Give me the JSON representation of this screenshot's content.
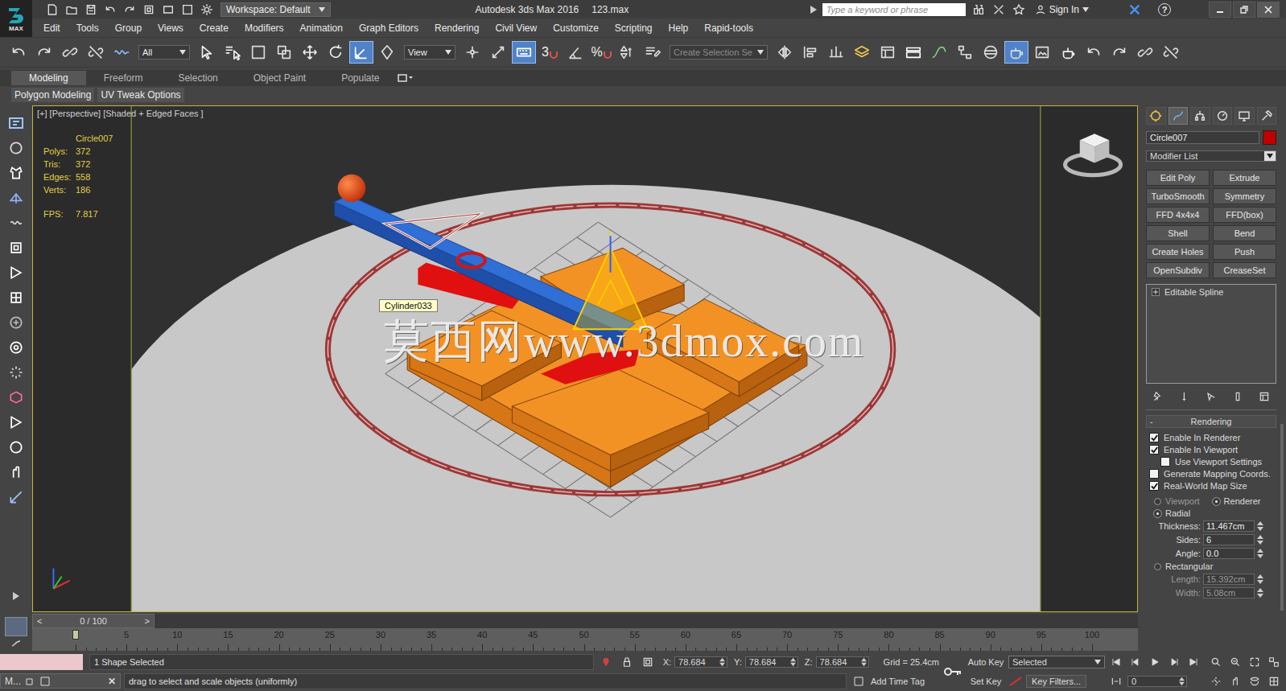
{
  "window": {
    "logo": "MAX",
    "title": "Autodesk 3ds Max 2016",
    "file": "123.max",
    "workspace": "Workspace: Default",
    "search_placeholder": "Type a keyword or phrase",
    "sign_in": "Sign In",
    "help": "?"
  },
  "menu": [
    "Edit",
    "Tools",
    "Group",
    "Views",
    "Create",
    "Modifiers",
    "Animation",
    "Graph Editors",
    "Rendering",
    "Civil View",
    "Customize",
    "Scripting",
    "Help",
    "Rapid-tools"
  ],
  "toolbar": {
    "items": [
      {
        "kind": "button",
        "selected": false
      },
      {
        "kind": "button",
        "selected": false
      },
      {
        "kind": "button",
        "selected": false
      },
      {
        "kind": "button",
        "selected": false
      },
      {
        "kind": "button",
        "selected": false
      },
      {
        "kind": "dropdown",
        "label": "All",
        "disabled": false
      },
      {
        "kind": "button",
        "selected": false
      },
      {
        "kind": "button",
        "selected": false
      },
      {
        "kind": "button",
        "selected": false
      },
      {
        "kind": "button",
        "selected": false
      },
      {
        "kind": "button",
        "selected": false
      },
      {
        "kind": "button",
        "selected": false
      },
      {
        "kind": "button",
        "selected": true
      },
      {
        "kind": "button",
        "selected": false
      },
      {
        "kind": "dropdown",
        "label": "View",
        "disabled": false
      },
      {
        "kind": "button",
        "selected": false
      },
      {
        "kind": "button",
        "selected": false
      },
      {
        "kind": "button",
        "selected": true
      },
      {
        "kind": "snap",
        "label": "3",
        "selected": false
      },
      {
        "kind": "button",
        "selected": false
      },
      {
        "kind": "snap",
        "label": "%",
        "selected": false
      },
      {
        "kind": "button",
        "selected": false
      },
      {
        "kind": "button",
        "selected": false
      },
      {
        "kind": "dropdown",
        "label": "Create Selection Se",
        "disabled": true
      },
      {
        "kind": "button",
        "selected": false
      },
      {
        "kind": "button",
        "selected": false
      },
      {
        "kind": "button",
        "selected": false
      },
      {
        "kind": "button",
        "selected": false
      },
      {
        "kind": "button",
        "selected": false
      },
      {
        "kind": "button",
        "selected": false
      },
      {
        "kind": "button",
        "selected": false
      },
      {
        "kind": "button",
        "selected": false
      },
      {
        "kind": "button",
        "selected": false
      },
      {
        "kind": "button",
        "selected": true
      },
      {
        "kind": "button",
        "selected": false
      },
      {
        "kind": "button",
        "selected": false
      },
      {
        "kind": "button",
        "selected": false
      },
      {
        "kind": "button",
        "selected": false
      },
      {
        "kind": "button",
        "selected": false
      },
      {
        "kind": "button",
        "selected": false
      }
    ]
  },
  "ribbon": {
    "tabs": [
      {
        "label": "Modeling",
        "selected": true
      },
      {
        "label": "Freeform",
        "selected": false
      },
      {
        "label": "Selection",
        "selected": false
      },
      {
        "label": "Object Paint",
        "selected": false
      },
      {
        "label": "Populate",
        "selected": false
      }
    ],
    "panels": [
      "Polygon Modeling",
      "UV Tweak Options"
    ]
  },
  "viewport": {
    "label": "[+] [Perspective] [Shaded + Edged Faces ]",
    "active": true,
    "stats": {
      "object": "Circle007",
      "rows": [
        {
          "label": "Polys:",
          "value": "372"
        },
        {
          "label": "Tris:",
          "value": "372"
        },
        {
          "label": "Edges:",
          "value": "558"
        },
        {
          "label": "Verts:",
          "value": "186"
        }
      ],
      "fps_label": "FPS:",
      "fps": "7.817"
    },
    "tooltip": "Cylinder033",
    "watermark": "莫西网www.3dmox.com",
    "gizmo_axis": "z"
  },
  "command_panel": {
    "tabs": [
      {
        "selected": false
      },
      {
        "selected": true
      },
      {
        "selected": false
      },
      {
        "selected": false
      },
      {
        "selected": false
      },
      {
        "selected": false
      }
    ],
    "object_name": "Circle007",
    "object_color": "#c00000",
    "modifier_list": "Modifier List",
    "modifier_buttons": [
      "Edit Poly",
      "Extrude",
      "TurboSmooth",
      "Symmetry",
      "FFD 4x4x4",
      "FFD(box)",
      "Shell",
      "Bend",
      "Create Holes",
      "Push",
      "OpenSubdiv",
      "CreaseSet"
    ],
    "stack": [
      {
        "label": "Editable Spline",
        "expanded": false,
        "selected": false
      }
    ],
    "rollout": {
      "title": "Rendering",
      "toggle": "-",
      "controls": [
        {
          "kind": "checkbox",
          "label": "Enable In Renderer",
          "checked": true
        },
        {
          "kind": "checkbox",
          "label": "Enable In Viewport",
          "checked": true
        },
        {
          "kind": "subcheckbox",
          "label": "Use Viewport Settings",
          "checked": false
        },
        {
          "kind": "checkbox",
          "label": "Generate Mapping Coords.",
          "checked": false
        },
        {
          "kind": "checkbox",
          "label": "Real-World Map Size",
          "checked": true
        },
        {
          "kind": "radiopair",
          "options": [
            {
              "label": "Viewport",
              "selected": false,
              "disabled": true
            },
            {
              "label": "Renderer",
              "selected": true,
              "disabled": false
            }
          ]
        },
        {
          "kind": "radio",
          "label": "Radial",
          "selected": true
        },
        {
          "kind": "spinner",
          "label": "Thickness:",
          "value": "11.467cm",
          "disabled": false
        },
        {
          "kind": "spinner",
          "label": "Sides:",
          "value": "6",
          "disabled": false
        },
        {
          "kind": "spinner",
          "label": "Angle:",
          "value": "0.0",
          "disabled": false
        },
        {
          "kind": "radio",
          "label": "Rectangular",
          "selected": false
        },
        {
          "kind": "spinner",
          "label": "Length:",
          "value": "15.392cm",
          "disabled": true
        },
        {
          "kind": "spinner",
          "label": "Width:",
          "value": "5.08cm",
          "disabled": true
        }
      ]
    }
  },
  "timeline": {
    "prev": "<",
    "next": ">",
    "label": "0 / 100",
    "current": "0",
    "end": "100",
    "ticks": [
      "5",
      "10",
      "15",
      "20",
      "25",
      "30",
      "35",
      "40",
      "45",
      "50",
      "55",
      "60",
      "65",
      "70",
      "75",
      "80",
      "85",
      "90",
      "95",
      "100"
    ]
  },
  "status": {
    "listener_tab": "M...",
    "listener_close": "✕",
    "selection": "1 Shape Selected",
    "prompt": "drag to select and scale objects (uniformly)",
    "coords": [
      {
        "axis": "X:",
        "value": "78.684"
      },
      {
        "axis": "Y:",
        "value": "78.684"
      },
      {
        "axis": "Z:",
        "value": "78.684"
      }
    ],
    "grid": "Grid = 25.4cm",
    "add_time_tag": "Add Time Tag",
    "auto_key": {
      "label": "Auto Key",
      "on": false
    },
    "set_key": "Set Key",
    "key_mode": "Selected",
    "key_filters": "Key Filters...",
    "frame": "0"
  }
}
